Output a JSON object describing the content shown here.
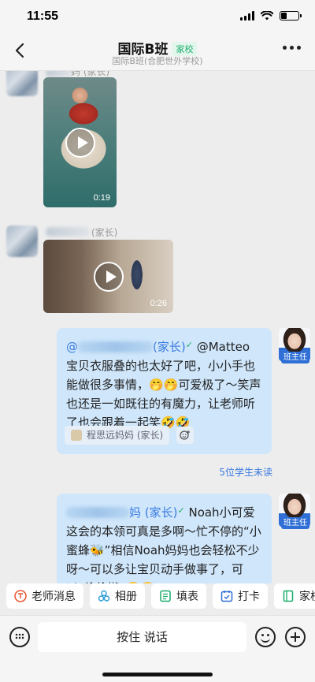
{
  "status_bar": {
    "time": "11:55",
    "battery_level": 0.35
  },
  "header": {
    "title": "国际B班",
    "tag": "家校",
    "subtitle": "国际B班(合肥世外学校)"
  },
  "messages": [
    {
      "type": "video",
      "sender_suffix": "妈 (家长)",
      "duration": "0:19"
    },
    {
      "type": "video",
      "sender_suffix": "(家长)",
      "duration": "0:26"
    },
    {
      "type": "text",
      "mention_head": "@",
      "mention_tail": "(家长)",
      "verified": "✓",
      "text": " @Matteo 宝贝衣服叠的也太好了吧，小小手也能做很多事情，🤭🤭可爱极了～笑声也还是一如既往的有魔力，让老师听了也会跟着一起笑🤣🤣",
      "quote": "程思远妈妈 (家长)",
      "avatar_tag": "班主任",
      "unread": "5位学生未读"
    },
    {
      "type": "text",
      "mention_tail": "妈 (家长)",
      "verified": "✓",
      "text": " Noah小可爱这会的本领可真是多啊～忙不停的“小蜜蜂🐝”相信Noah妈妈也会轻松不少呀～可以多让宝贝动手做事了，可以“偷偷懒”🤭🤭",
      "avatar_tag": "班主任"
    }
  ],
  "quick_actions": [
    {
      "label": "老师消息",
      "icon": "teacher-message-icon",
      "color": "#e8542f"
    },
    {
      "label": "相册",
      "icon": "album-icon",
      "color": "#2b9bd6"
    },
    {
      "label": "填表",
      "icon": "form-icon",
      "color": "#1aad6a"
    },
    {
      "label": "打卡",
      "icon": "checkin-icon",
      "color": "#2f6fd6"
    },
    {
      "label": "家校本",
      "icon": "notebook-icon",
      "color": "#1aad6a"
    }
  ],
  "input_bar": {
    "hold_to_talk": "按住 说话"
  }
}
